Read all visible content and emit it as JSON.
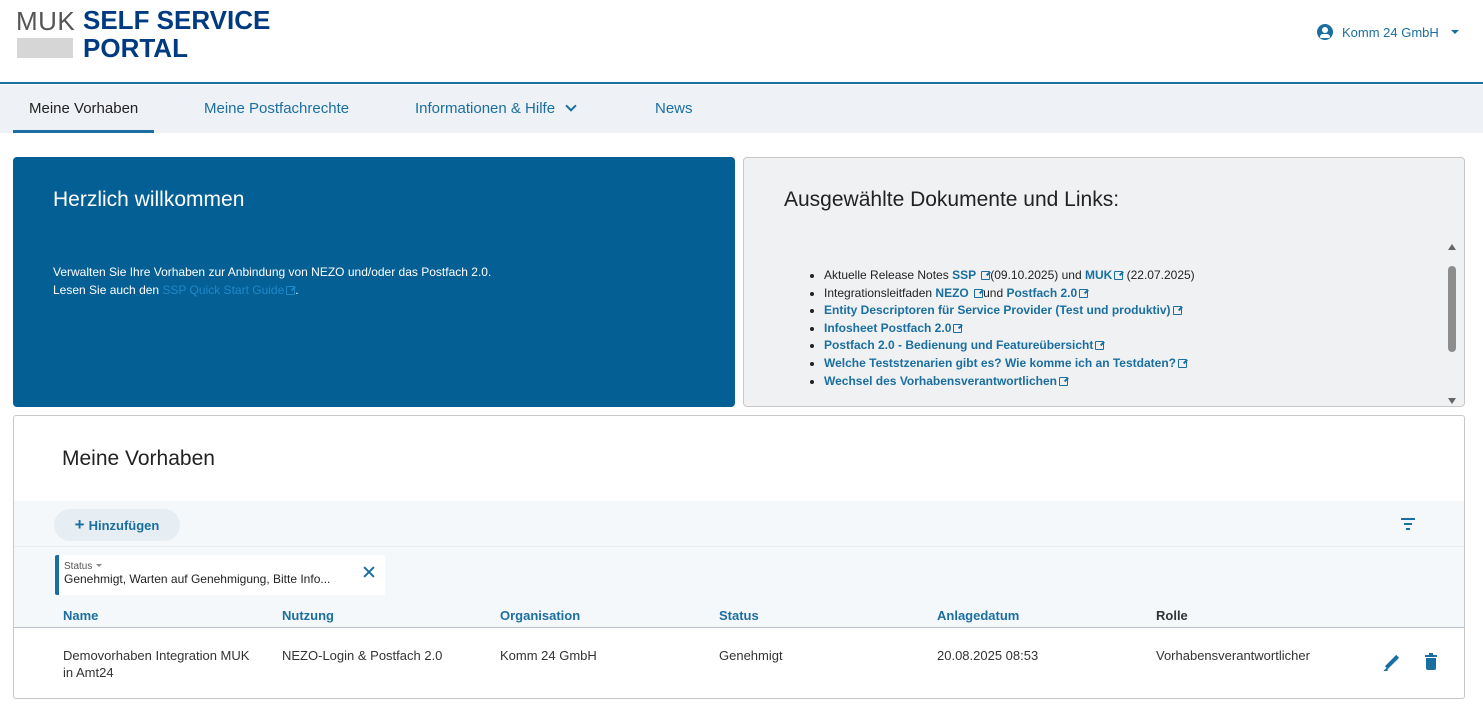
{
  "header": {
    "logo_muk": "MUK",
    "logo_line1": "SELF SERVICE",
    "logo_line2": "PORTAL",
    "user_name": "Komm 24 GmbH"
  },
  "nav": {
    "items": [
      {
        "label": "Meine Vorhaben",
        "active": true
      },
      {
        "label": "Meine Postfachrechte"
      },
      {
        "label": "Informationen & Hilfe"
      },
      {
        "label": "News"
      }
    ]
  },
  "welcome": {
    "title": "Herzlich willkommen",
    "line1": "Verwalten Sie Ihre Vorhaben zur Anbindung von NEZO und/oder das Postfach 2.0.",
    "line2_prefix": "Lesen Sie auch den ",
    "line2_link": "SSP Quick Start Guide",
    "line2_suffix": "."
  },
  "docs": {
    "title": "Ausgewählte Dokumente und Links:",
    "item1": {
      "t1": "Aktuelle Release Notes ",
      "link1": "SSP",
      "t2": "(09.10.2025) und ",
      "link2": "MUK",
      "t3": " (22.07.2025)"
    },
    "item2": {
      "t1": "Integrationsleitfaden ",
      "link1": "NEZO",
      "t2": "und ",
      "link2": "Postfach 2.0"
    },
    "item3": "Entity Descriptoren für Service Provider (Test und produktiv)",
    "item4": "Infosheet Postfach 2.0",
    "item5": "Postfach 2.0 - Bedienung und Featureübersicht",
    "item6": "Welche Teststzenarien gibt es? Wie komme ich an Testdaten?",
    "item7": "Wechsel des Vorhabensverantwortlichen"
  },
  "projects": {
    "title": "Meine Vorhaben",
    "add_label": "Hinzufügen",
    "filter": {
      "label": "Status",
      "value": "Genehmigt, Warten auf Genehmigung, Bitte Info..."
    },
    "columns": [
      "Name",
      "Nutzung",
      "Organisation",
      "Status",
      "Anlagedatum",
      "Rolle"
    ],
    "rows": [
      {
        "name_line1": "Demovorhaben Integration MUK",
        "name_line2": "in Amt24",
        "nutzung": "NEZO-Login & Postfach 2.0",
        "organisation": "Komm 24 GmbH",
        "status": "Genehmigt",
        "anlagedatum": "20.08.2025 08:53",
        "rolle": "Vorhabensverantwortlicher"
      }
    ]
  },
  "colors": {
    "brand_dark": "#003a80",
    "primary": "#1a6fa0",
    "welcome_bg": "#045f95",
    "nav_bg": "#eef1f5"
  }
}
